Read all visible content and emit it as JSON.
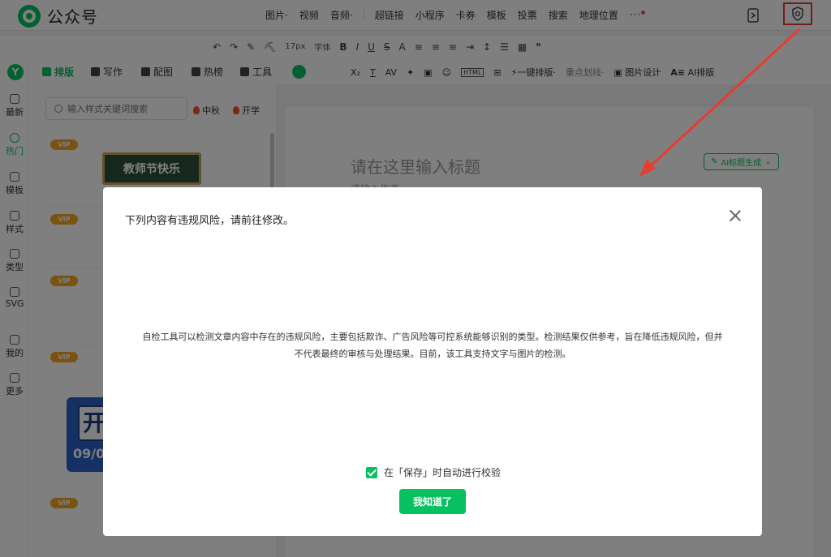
{
  "app": {
    "name": "公众号"
  },
  "insert_menu": [
    {
      "label": "图片",
      "dropdown": true
    },
    {
      "label": "视频",
      "dropdown": false
    },
    {
      "label": "音频",
      "dropdown": true
    },
    {
      "label": "超链接",
      "dropdown": false
    },
    {
      "label": "小程序",
      "dropdown": false
    },
    {
      "label": "卡券",
      "dropdown": false
    },
    {
      "label": "模板",
      "dropdown": false
    },
    {
      "label": "投票",
      "dropdown": false
    },
    {
      "label": "搜索",
      "dropdown": false
    },
    {
      "label": "地理位置",
      "dropdown": false
    }
  ],
  "more_label": "···",
  "toolbar": {
    "undo": "↶",
    "redo": "↷",
    "clear_format": "✎",
    "format_brush": "⛏",
    "font_size": "17px",
    "font_family": "字体",
    "bold": "B",
    "italic": "I",
    "underline": "U",
    "strike": "S",
    "text_color": "A"
  },
  "rail": [
    {
      "label": "最新",
      "active": false
    },
    {
      "label": "热门",
      "active": true
    },
    {
      "label": "模板",
      "active": false
    },
    {
      "label": "样式",
      "active": false
    },
    {
      "label": "类型",
      "active": false
    },
    {
      "label": "SVG",
      "active": false
    },
    {
      "label": "我的",
      "active": false
    },
    {
      "label": "更多",
      "active": false
    }
  ],
  "rail_logo": "Y",
  "side_tabs": [
    {
      "label": "排版",
      "active": true
    },
    {
      "label": "写作",
      "active": false
    },
    {
      "label": "配图",
      "active": false
    },
    {
      "label": "热榜",
      "active": false
    },
    {
      "label": "工具",
      "active": false
    }
  ],
  "fmt2": {
    "sub": "X₂",
    "t": "T",
    "av": "AV",
    "wand": "✦",
    "img": "▣",
    "emoji": "☺",
    "html": "HTML",
    "one_click": "一键排版",
    "highlight": "重点划线",
    "img_design": "图片设计",
    "ai": "AI排版"
  },
  "panel": {
    "search_placeholder": "输入样式关键词搜索",
    "hot_tags": [
      "中秋",
      "开学"
    ],
    "vip_label": "VIP",
    "teacher_card": "教师节快乐",
    "blue_card_char": "开",
    "blue_card_date": "09/0"
  },
  "editor": {
    "title_placeholder": "请在这里输入标题",
    "author_placeholder": "请输入作者",
    "ai_title_button": "AI标题生成"
  },
  "dialog": {
    "title": "下列内容有违规风险，请前往修改。",
    "description": "自检工具可以检测文章内容中存在的违规风险，主要包括欺诈、广告风险等可控系统能够识别的类型。检测结果仅供参考，旨在降低违规风险，但并不代表最终的审核与处理结果。目前，该工具支持文字与图片的检测。",
    "checkbox_label": "在「保存」时自动进行校验",
    "checkbox_checked": true,
    "confirm_button": "我知道了"
  },
  "colors": {
    "brand_green": "#07c160",
    "annotation_red": "#e63c31",
    "vip_orange": "#f5a623"
  }
}
